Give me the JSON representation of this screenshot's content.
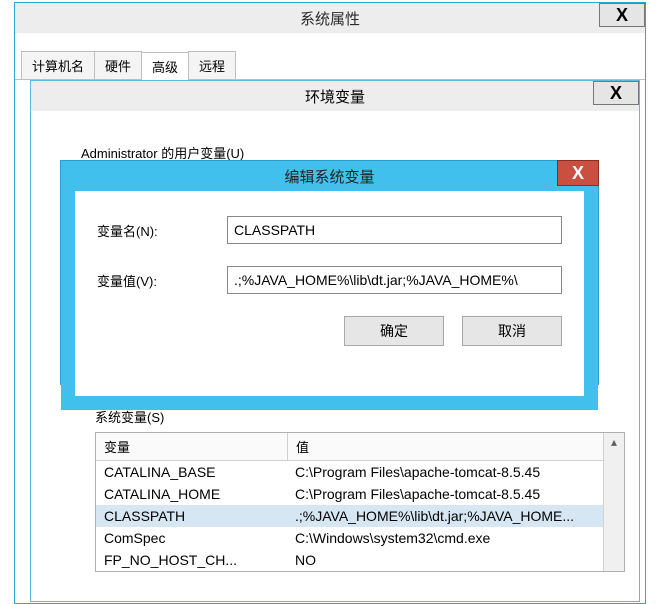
{
  "sys_prop": {
    "title": "系统属性",
    "tabs": [
      "计算机名",
      "硬件",
      "高级",
      "远程"
    ],
    "active_tab": 2
  },
  "env_dialog": {
    "title": "环境变量",
    "user_label": "Administrator 的用户变量(U)"
  },
  "edit_dialog": {
    "title": "编辑系统变量",
    "name_label": "变量名(N):",
    "value_label": "变量值(V):",
    "name_value": "CLASSPATH",
    "value_value": ".;%JAVA_HOME%\\lib\\dt.jar;%JAVA_HOME%\\",
    "ok": "确定",
    "cancel": "取消"
  },
  "sys_vars": {
    "label": "系统变量(S)",
    "columns": {
      "var": "变量",
      "val": "值"
    },
    "rows": [
      {
        "var": "CATALINA_BASE",
        "val": "C:\\Program Files\\apache-tomcat-8.5.45"
      },
      {
        "var": "CATALINA_HOME",
        "val": "C:\\Program Files\\apache-tomcat-8.5.45"
      },
      {
        "var": "CLASSPATH",
        "val": ".;%JAVA_HOME%\\lib\\dt.jar;%JAVA_HOME..."
      },
      {
        "var": "ComSpec",
        "val": "C:\\Windows\\system32\\cmd.exe"
      },
      {
        "var": "FP_NO_HOST_CH...",
        "val": "NO"
      }
    ],
    "selected": 2
  },
  "glyphs": {
    "close": "X",
    "up": "▴"
  }
}
